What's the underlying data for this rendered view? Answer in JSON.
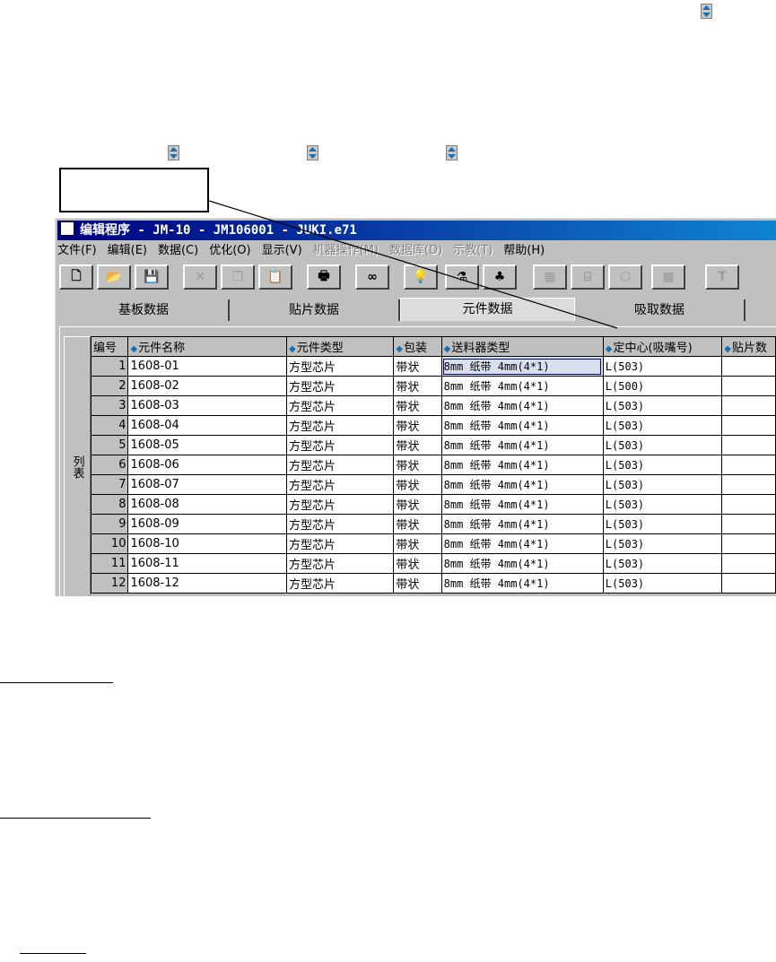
{
  "window": {
    "title": "编辑程序  - JM-10 - JM106001 - JUKI.e71"
  },
  "menu": [
    {
      "label": "文件(F)",
      "enabled": true
    },
    {
      "label": "编辑(E)",
      "enabled": true
    },
    {
      "label": "数据(C)",
      "enabled": true
    },
    {
      "label": "优化(O)",
      "enabled": true
    },
    {
      "label": "显示(V)",
      "enabled": true
    },
    {
      "label": "机器操作(M)",
      "enabled": false
    },
    {
      "label": "数据库(D)",
      "enabled": false
    },
    {
      "label": "示教(T)",
      "enabled": false
    },
    {
      "label": "帮助(H)",
      "enabled": true
    }
  ],
  "toolbar": [
    {
      "icon": "new-file-icon",
      "glyph": "🗋",
      "enabled": true
    },
    {
      "icon": "open-folder-icon",
      "glyph": "📂",
      "enabled": true
    },
    {
      "icon": "save-icon",
      "glyph": "💾",
      "enabled": true
    },
    {
      "icon": "cut-icon",
      "glyph": "✕",
      "enabled": false
    },
    {
      "icon": "copy-icon",
      "glyph": "❐",
      "enabled": false
    },
    {
      "icon": "paste-icon",
      "glyph": "📋",
      "enabled": true
    },
    {
      "icon": "print-icon",
      "glyph": "🖶",
      "enabled": true
    },
    {
      "icon": "find-icon",
      "glyph": "∞",
      "enabled": true
    },
    {
      "icon": "lightbulb-icon",
      "glyph": "💡",
      "enabled": true
    },
    {
      "icon": "nozzle-icon",
      "glyph": "⚗",
      "enabled": true
    },
    {
      "icon": "components-icon",
      "glyph": "♣",
      "enabled": true
    },
    {
      "icon": "grid-icon",
      "glyph": "▦",
      "enabled": false
    },
    {
      "icon": "feeder-icon",
      "glyph": "⌸",
      "enabled": false
    },
    {
      "icon": "package-icon",
      "glyph": "⬡",
      "enabled": false
    },
    {
      "icon": "machine-icon",
      "glyph": "▩",
      "enabled": false
    },
    {
      "icon": "text-icon",
      "glyph": "T",
      "enabled": false
    }
  ],
  "tabs": [
    {
      "label": "基板数据",
      "active": false
    },
    {
      "label": "贴片数据",
      "active": false
    },
    {
      "label": "元件数据",
      "active": true
    },
    {
      "label": "吸取数据",
      "active": false
    }
  ],
  "side_tab": "列表",
  "table": {
    "headers": [
      "编号",
      "元件名称",
      "元件类型",
      "包装",
      "送料器类型",
      "定中心(吸嘴号)",
      "贴片数"
    ],
    "rows": [
      [
        "1",
        "1608-01",
        "方型芯片",
        "带状",
        "8mm 纸带  4mm(4*1)",
        "L(503)",
        ""
      ],
      [
        "2",
        "1608-02",
        "方型芯片",
        "带状",
        "8mm 纸带  4mm(4*1)",
        "L(500)",
        ""
      ],
      [
        "3",
        "1608-03",
        "方型芯片",
        "带状",
        "8mm 纸带  4mm(4*1)",
        "L(503)",
        ""
      ],
      [
        "4",
        "1608-04",
        "方型芯片",
        "带状",
        "8mm 纸带  4mm(4*1)",
        "L(503)",
        ""
      ],
      [
        "5",
        "1608-05",
        "方型芯片",
        "带状",
        "8mm 纸带  4mm(4*1)",
        "L(503)",
        ""
      ],
      [
        "6",
        "1608-06",
        "方型芯片",
        "带状",
        "8mm 纸带  4mm(4*1)",
        "L(503)",
        ""
      ],
      [
        "7",
        "1608-07",
        "方型芯片",
        "带状",
        "8mm 纸带  4mm(4*1)",
        "L(503)",
        ""
      ],
      [
        "8",
        "1608-08",
        "方型芯片",
        "带状",
        "8mm 纸带  4mm(4*1)",
        "L(503)",
        ""
      ],
      [
        "9",
        "1608-09",
        "方型芯片",
        "带状",
        "8mm 纸带  4mm(4*1)",
        "L(503)",
        ""
      ],
      [
        "10",
        "1608-10",
        "方型芯片",
        "带状",
        "8mm 纸带  4mm(4*1)",
        "L(503)",
        ""
      ],
      [
        "11",
        "1608-11",
        "方型芯片",
        "带状",
        "8mm 纸带  4mm(4*1)",
        "L(503)",
        ""
      ],
      [
        "12",
        "1608-12",
        "方型芯片",
        "带状",
        "8mm 纸带  4mm(4*1)",
        "L(503)",
        ""
      ]
    ]
  },
  "colors": {
    "title_start": "#000080",
    "title_end": "#1084d0",
    "face": "#c0c0c0",
    "sort_arrow": "#1a6fb0"
  }
}
